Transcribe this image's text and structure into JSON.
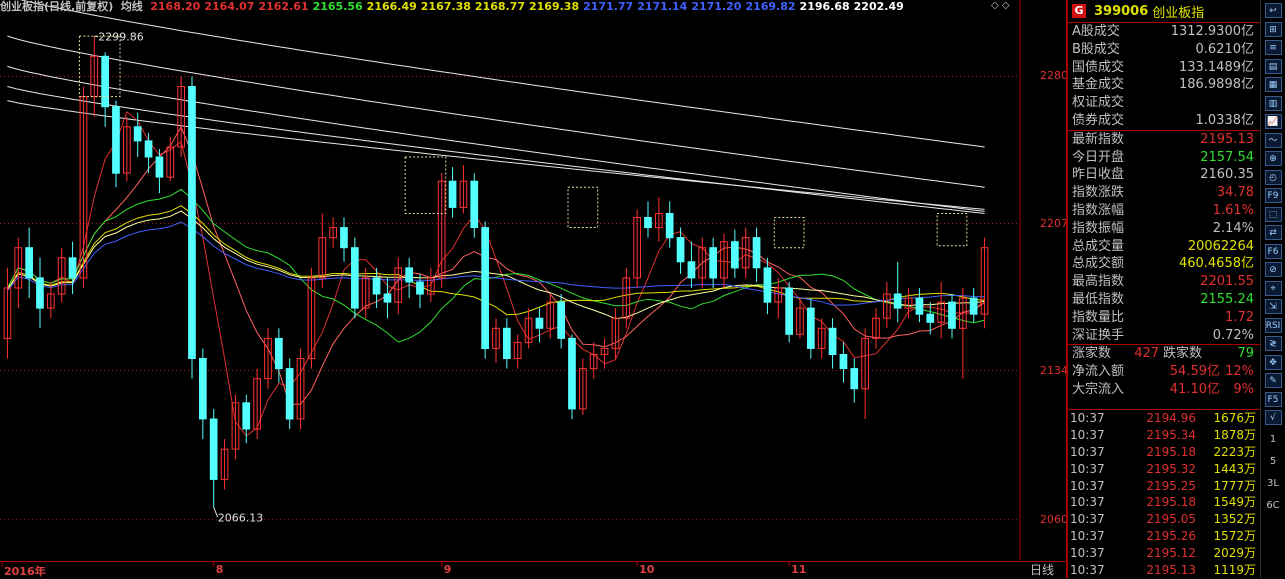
{
  "title_bar": {
    "name": "创业板指(日线,前复权)",
    "indicator": "均线",
    "ma_values": [
      {
        "value": "2168.20",
        "color": "#e03030"
      },
      {
        "value": "2164.07",
        "color": "#e03030"
      },
      {
        "value": "2162.61",
        "color": "#e03030"
      },
      {
        "value": "2165.56",
        "color": "#30e030"
      },
      {
        "value": "2166.49",
        "color": "#e0e000"
      },
      {
        "value": "2167.38",
        "color": "#e0e000"
      },
      {
        "value": "2168.77",
        "color": "#e0e000"
      },
      {
        "value": "2169.38",
        "color": "#e0e000"
      },
      {
        "value": "2171.77",
        "color": "#4060ff"
      },
      {
        "value": "2171.14",
        "color": "#4060ff"
      },
      {
        "value": "2171.20",
        "color": "#4060ff"
      },
      {
        "value": "2169.82",
        "color": "#4060ff"
      },
      {
        "value": "2196.68",
        "color": "#ffffff"
      },
      {
        "value": "2202.49",
        "color": "#ffffff"
      }
    ],
    "corner_icons": "◇ ◇"
  },
  "chart_data": {
    "type": "candlestick",
    "y_axis_ticks": [
      "2280",
      "2207",
      "2134",
      "2060"
    ],
    "ylim": [
      2040,
      2310
    ],
    "x_ticks": [
      {
        "label": "2016年",
        "index": 0
      },
      {
        "label": "8",
        "index": 19
      },
      {
        "label": "9",
        "index": 40
      },
      {
        "label": "10",
        "index": 58
      },
      {
        "label": "11",
        "index": 72
      }
    ],
    "annotations": [
      {
        "text": "2299.86",
        "index": 8
      },
      {
        "text": "2066.13",
        "index": 19
      }
    ],
    "period": "日线",
    "candles": [
      [
        2150,
        2175,
        2140,
        2185
      ],
      [
        2175,
        2195,
        2165,
        2200
      ],
      [
        2195,
        2180,
        2170,
        2205
      ],
      [
        2180,
        2165,
        2155,
        2190
      ],
      [
        2165,
        2172,
        2160,
        2178
      ],
      [
        2172,
        2190,
        2168,
        2195
      ],
      [
        2190,
        2180,
        2172,
        2198
      ],
      [
        2180,
        2270,
        2175,
        2275
      ],
      [
        2270,
        2290,
        2260,
        2300
      ],
      [
        2290,
        2265,
        2255,
        2292
      ],
      [
        2265,
        2232,
        2225,
        2268
      ],
      [
        2232,
        2255,
        2228,
        2260
      ],
      [
        2255,
        2248,
        2240,
        2262
      ],
      [
        2248,
        2240,
        2232,
        2252
      ],
      [
        2240,
        2230,
        2222,
        2244
      ],
      [
        2230,
        2245,
        2228,
        2250
      ],
      [
        2245,
        2275,
        2240,
        2280
      ],
      [
        2275,
        2140,
        2130,
        2280
      ],
      [
        2140,
        2110,
        2100,
        2145
      ],
      [
        2110,
        2080,
        2066,
        2115
      ],
      [
        2080,
        2095,
        2075,
        2100
      ],
      [
        2095,
        2118,
        2090,
        2122
      ],
      [
        2118,
        2105,
        2098,
        2122
      ],
      [
        2105,
        2130,
        2100,
        2135
      ],
      [
        2130,
        2150,
        2125,
        2155
      ],
      [
        2150,
        2135,
        2128,
        2155
      ],
      [
        2135,
        2110,
        2105,
        2140
      ],
      [
        2110,
        2140,
        2105,
        2145
      ],
      [
        2140,
        2180,
        2135,
        2185
      ],
      [
        2180,
        2200,
        2175,
        2212
      ],
      [
        2200,
        2205,
        2195,
        2210
      ],
      [
        2205,
        2195,
        2188,
        2210
      ],
      [
        2195,
        2165,
        2160,
        2200
      ],
      [
        2165,
        2180,
        2160,
        2185
      ],
      [
        2180,
        2172,
        2165,
        2185
      ],
      [
        2172,
        2168,
        2160,
        2180
      ],
      [
        2168,
        2185,
        2162,
        2190
      ],
      [
        2185,
        2178,
        2170,
        2190
      ],
      [
        2178,
        2172,
        2165,
        2182
      ],
      [
        2172,
        2180,
        2168,
        2185
      ],
      [
        2180,
        2228,
        2175,
        2232
      ],
      [
        2228,
        2215,
        2210,
        2235
      ],
      [
        2215,
        2228,
        2212,
        2236
      ],
      [
        2228,
        2205,
        2200,
        2232
      ],
      [
        2205,
        2145,
        2140,
        2208
      ],
      [
        2145,
        2155,
        2138,
        2160
      ],
      [
        2155,
        2140,
        2135,
        2160
      ],
      [
        2140,
        2148,
        2135,
        2152
      ],
      [
        2148,
        2160,
        2145,
        2165
      ],
      [
        2160,
        2155,
        2148,
        2165
      ],
      [
        2155,
        2168,
        2150,
        2172
      ],
      [
        2168,
        2150,
        2145,
        2172
      ],
      [
        2150,
        2115,
        2110,
        2152
      ],
      [
        2115,
        2135,
        2112,
        2140
      ],
      [
        2135,
        2142,
        2130,
        2148
      ],
      [
        2142,
        2145,
        2135,
        2150
      ],
      [
        2145,
        2160,
        2140,
        2165
      ],
      [
        2160,
        2180,
        2155,
        2185
      ],
      [
        2180,
        2210,
        2175,
        2214
      ],
      [
        2210,
        2205,
        2200,
        2218
      ],
      [
        2205,
        2212,
        2198,
        2220
      ],
      [
        2212,
        2200,
        2195,
        2218
      ],
      [
        2200,
        2188,
        2182,
        2205
      ],
      [
        2188,
        2180,
        2175,
        2198
      ],
      [
        2180,
        2195,
        2175,
        2200
      ],
      [
        2195,
        2180,
        2175,
        2200
      ],
      [
        2180,
        2198,
        2175,
        2202
      ],
      [
        2198,
        2185,
        2180,
        2204
      ],
      [
        2185,
        2200,
        2180,
        2205
      ],
      [
        2200,
        2185,
        2178,
        2205
      ],
      [
        2185,
        2168,
        2162,
        2190
      ],
      [
        2168,
        2175,
        2160,
        2180
      ],
      [
        2175,
        2152,
        2148,
        2178
      ],
      [
        2152,
        2165,
        2150,
        2170
      ],
      [
        2165,
        2145,
        2140,
        2170
      ],
      [
        2145,
        2155,
        2140,
        2160
      ],
      [
        2155,
        2142,
        2135,
        2160
      ],
      [
        2142,
        2135,
        2128,
        2148
      ],
      [
        2135,
        2125,
        2118,
        2140
      ],
      [
        2125,
        2150,
        2110,
        2155
      ],
      [
        2150,
        2160,
        2145,
        2165
      ],
      [
        2160,
        2172,
        2155,
        2178
      ],
      [
        2172,
        2165,
        2158,
        2188
      ],
      [
        2165,
        2170,
        2160,
        2175
      ],
      [
        2170,
        2162,
        2158,
        2175
      ],
      [
        2162,
        2158,
        2152,
        2168
      ],
      [
        2158,
        2168,
        2150,
        2178
      ],
      [
        2168,
        2155,
        2150,
        2172
      ],
      [
        2155,
        2170,
        2130,
        2175
      ],
      [
        2170,
        2162,
        2158,
        2175
      ],
      [
        2162,
        2195,
        2155,
        2200
      ]
    ],
    "ma_lines": [
      {
        "color": "#e03030",
        "period": 5
      },
      {
        "color": "#ff6060",
        "period": 10
      },
      {
        "color": "#30e030",
        "period": 20
      },
      {
        "color": "#e0e000",
        "period": 30
      },
      {
        "color": "#ffffa0",
        "period": 40
      },
      {
        "color": "#4060ff",
        "period": 60
      }
    ]
  },
  "panel": {
    "code": "399006",
    "name": "创业板指",
    "rows": [
      {
        "label": "A股成交",
        "value": "1312.9300亿",
        "color": "#c0c0c0"
      },
      {
        "label": "B股成交",
        "value": "0.6210亿",
        "color": "#c0c0c0"
      },
      {
        "label": "国债成交",
        "value": "133.1489亿",
        "color": "#c0c0c0"
      },
      {
        "label": "基金成交",
        "value": "186.9898亿",
        "color": "#c0c0c0"
      },
      {
        "label": "权证成交",
        "value": "",
        "color": "#c0c0c0"
      },
      {
        "label": "债券成交",
        "value": "1.0338亿",
        "color": "#c0c0c0"
      }
    ],
    "rows2": [
      {
        "label": "最新指数",
        "value": "2195.13",
        "color": "#e03030"
      },
      {
        "label": "今日开盘",
        "value": "2157.54",
        "color": "#30e030"
      },
      {
        "label": "昨日收盘",
        "value": "2160.35",
        "color": "#c0c0c0"
      },
      {
        "label": "指数涨跌",
        "value": "34.78",
        "color": "#e03030"
      },
      {
        "label": "指数涨幅",
        "value": "1.61%",
        "color": "#e03030"
      },
      {
        "label": "指数振幅",
        "value": "2.14%",
        "color": "#c0c0c0"
      },
      {
        "label": "总成交量",
        "value": "20062264",
        "color": "#e0e000"
      },
      {
        "label": "总成交额",
        "value": "460.4658亿",
        "color": "#e0e000"
      },
      {
        "label": "最高指数",
        "value": "2201.55",
        "color": "#e03030"
      },
      {
        "label": "最低指数",
        "value": "2155.24",
        "color": "#30e030"
      },
      {
        "label": "指数量比",
        "value": "1.72",
        "color": "#e03030"
      },
      {
        "label": "深证换手",
        "value": "0.72%",
        "color": "#c0c0c0"
      }
    ],
    "advance_label": "涨家数",
    "advance_value": "427",
    "decline_label": "跌家数",
    "decline_value": "79",
    "flows": [
      {
        "label": "净流入额",
        "value": "54.59亿",
        "pct": "12%"
      },
      {
        "label": "大宗流入",
        "value": "41.10亿",
        "pct": "9%"
      }
    ],
    "trades": [
      {
        "time": "10:37",
        "price": "2194.96",
        "vol": "1676万"
      },
      {
        "time": "10:37",
        "price": "2195.34",
        "vol": "1878万"
      },
      {
        "time": "10:37",
        "price": "2195.18",
        "vol": "2223万"
      },
      {
        "time": "10:37",
        "price": "2195.32",
        "vol": "1443万"
      },
      {
        "time": "10:37",
        "price": "2195.25",
        "vol": "1777万"
      },
      {
        "time": "10:37",
        "price": "2195.18",
        "vol": "1549万"
      },
      {
        "time": "10:37",
        "price": "2195.05",
        "vol": "1352万"
      },
      {
        "time": "10:37",
        "price": "2195.26",
        "vol": "1572万"
      },
      {
        "time": "10:37",
        "price": "2195.12",
        "vol": "2029万"
      },
      {
        "time": "10:37",
        "price": "2195.13",
        "vol": "1119万"
      }
    ]
  },
  "toolbar": {
    "buttons": [
      "↩",
      "⊞",
      "≡",
      "▤",
      "▦",
      "▥",
      "📈",
      "〜",
      "⊕",
      "◴",
      "F9",
      "⬚",
      "⇄",
      "F6",
      "⊘",
      "⌖",
      "⇲",
      "RSI",
      "≷",
      "✥",
      "✎",
      "F5",
      "√"
    ],
    "numbers": [
      "1",
      "5",
      "3L",
      "6C"
    ]
  }
}
